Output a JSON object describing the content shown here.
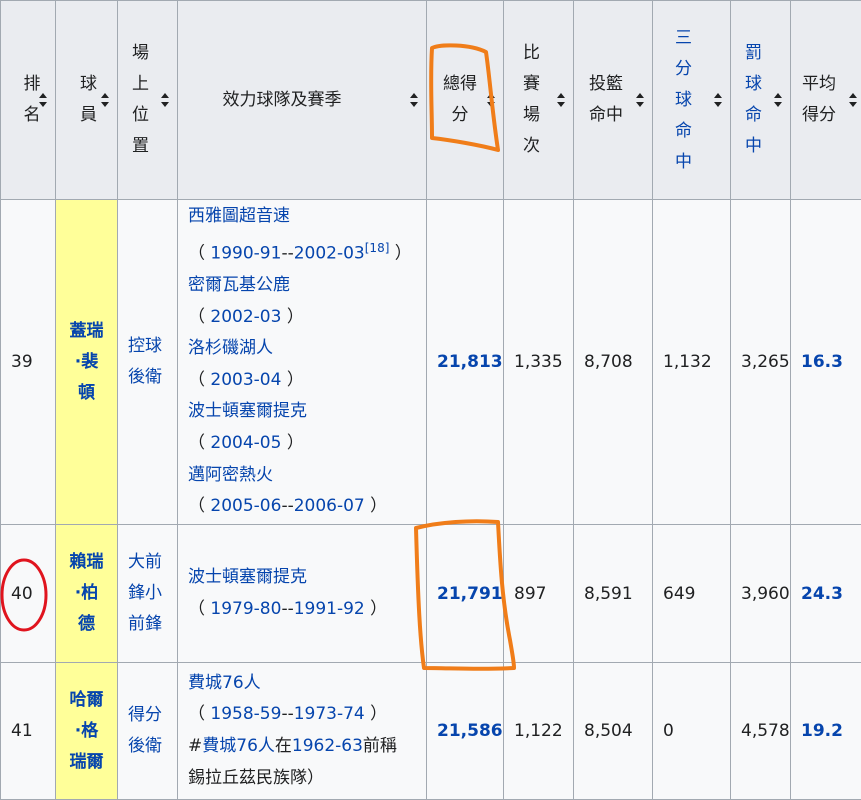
{
  "headers": {
    "rank": "排名",
    "player": "球員",
    "position": "場上位置",
    "teams": "效力球隊及賽季",
    "points": "總得分",
    "games": "比賽場次",
    "fg": "投籃命中",
    "three": "三分球命中",
    "ft": "罰球命中",
    "ppg": "平均得分"
  },
  "rows": [
    {
      "rank": "39",
      "player": "蓋瑞·裴頓",
      "position": "控球後衛",
      "teams_lines": [
        {
          "type": "team",
          "text": "西雅圖超音速"
        },
        {
          "type": "season",
          "a": "1990-91",
          "sep": "--",
          "b": "2002-03",
          "ref": "[18]"
        },
        {
          "type": "team",
          "text": "密爾瓦基公鹿"
        },
        {
          "type": "season",
          "a": "2002-03"
        },
        {
          "type": "team",
          "text": "洛杉磯湖人"
        },
        {
          "type": "season",
          "a": "2003-04"
        },
        {
          "type": "team",
          "text": "波士頓塞爾提克"
        },
        {
          "type": "season",
          "a": "2004-05"
        },
        {
          "type": "team",
          "text": "邁阿密熱火"
        },
        {
          "type": "season",
          "a": "2005-06",
          "sep": "--",
          "b": "2006-07"
        }
      ],
      "points": "21,813",
      "games": "1,335",
      "fg": "8,708",
      "three": "1,132",
      "ft": "3,265",
      "ppg": "16.3"
    },
    {
      "rank": "40",
      "player": "賴瑞·柏德",
      "position": "大前鋒小前鋒",
      "teams_lines": [
        {
          "type": "team",
          "text": "波士頓塞爾提克"
        },
        {
          "type": "season",
          "a": "1979-80",
          "sep": "--",
          "b": "1991-92"
        }
      ],
      "points": "21,791",
      "games": "897",
      "fg": "8,591",
      "three": "649",
      "ft": "3,960",
      "ppg": "24.3"
    },
    {
      "rank": "41",
      "player": "哈爾·格瑞爾",
      "position": "得分後衛",
      "teams_lines": [
        {
          "type": "team",
          "text": "費城76人"
        },
        {
          "type": "season",
          "a": "1958-59",
          "sep": "--",
          "b": "1973-74"
        },
        {
          "type": "note",
          "hash": "#",
          "link": "費城76人",
          "mid": "在",
          "link2": "1962-63",
          "rest": "前稱"
        },
        {
          "type": "plain",
          "text": "錫拉丘茲民族隊）"
        }
      ],
      "points": "21,586",
      "games": "1,122",
      "fg": "8,504",
      "three": "0",
      "ft": "4,578",
      "ppg": "19.2"
    }
  ],
  "colors": {
    "link": "#0645ad",
    "header_bg": "#eaecf0",
    "cell_bg": "#f8f9fa",
    "player_bg": "#ffff99",
    "border": "#a2a9b1",
    "annotation_orange": "#f07d19",
    "annotation_red": "#e0141e"
  }
}
